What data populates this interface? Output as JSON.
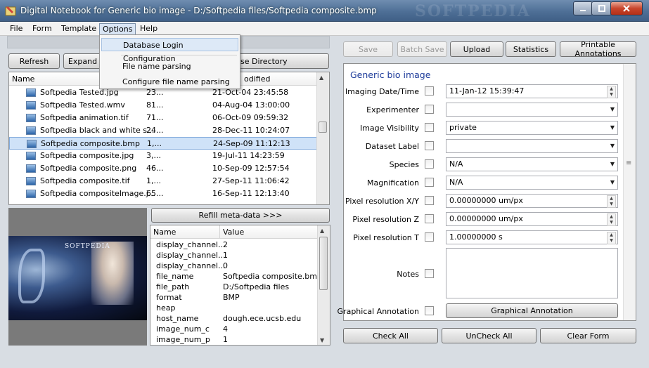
{
  "window": {
    "title": "Digital Notebook for Generic bio image - D:/Softpedia files/Softpedia composite.bmp",
    "watermark": "SOFTPEDIA"
  },
  "menubar": [
    "File",
    "Form",
    "Template",
    "Options",
    "Help"
  ],
  "options_menu": [
    "Database Login Configuration",
    "File name parsing",
    "Configure file name parsing"
  ],
  "left_toolbar": {
    "refresh": "Refresh",
    "expand": "Expand",
    "browse": "se Directory"
  },
  "file_list": {
    "headers": {
      "name": "Name",
      "modified": "odified"
    },
    "rows": [
      {
        "name": "Softpedia Tested.jpg",
        "size": "23...",
        "date": "21-Oct-04 23:45:58"
      },
      {
        "name": "Softpedia Tested.wmv",
        "size": "81...",
        "date": "04-Aug-04 13:00:00"
      },
      {
        "name": "Softpedia animation.tif",
        "size": "71...",
        "date": "06-Oct-09 09:59:32"
      },
      {
        "name": "Softpedia black and white s...",
        "size": "24...",
        "date": "28-Dec-11 10:24:07"
      },
      {
        "name": "Softpedia composite.bmp",
        "size": "1,...",
        "date": "24-Sep-09 11:12:13"
      },
      {
        "name": "Softpedia composite.jpg",
        "size": "3,...",
        "date": "19-Jul-11 14:23:59"
      },
      {
        "name": "Softpedia composite.png",
        "size": "46...",
        "date": "10-Sep-09 12:57:54"
      },
      {
        "name": "Softpedia composite.tif",
        "size": "1,...",
        "date": "27-Sep-11 11:06:42"
      },
      {
        "name": "Softpedia compositeImage.j...",
        "size": "65...",
        "date": "16-Sep-11 12:13:40"
      }
    ],
    "selected_index": 4
  },
  "preview": {
    "logo_text": "SOFTPEDIA"
  },
  "refill_button": "Refill meta-data >>>",
  "meta": {
    "headers": {
      "name": "Name",
      "value": "Value"
    },
    "rows": [
      {
        "k": "display_channel...",
        "v": "2"
      },
      {
        "k": "display_channel...",
        "v": "1"
      },
      {
        "k": "display_channel...",
        "v": "0"
      },
      {
        "k": "file_name",
        "v": "Softpedia composite.bmp"
      },
      {
        "k": "file_path",
        "v": "D:/Softpedia files"
      },
      {
        "k": "format",
        "v": "BMP"
      },
      {
        "k": "heap",
        "v": ""
      },
      {
        "k": "host_name",
        "v": "dough.ece.ucsb.edu"
      },
      {
        "k": "image_num_c",
        "v": "4"
      },
      {
        "k": "image_num_p",
        "v": "1"
      }
    ]
  },
  "right_toolbar": {
    "save": "Save",
    "batch_save": "Batch Save",
    "upload": "Upload",
    "statistics": "Statistics",
    "printable": "Printable Annotations"
  },
  "form": {
    "title": "Generic bio image",
    "imaging_label": "Imaging Date/Time",
    "imaging_value": "11-Jan-12 15:39:47",
    "experimenter_label": "Experimenter",
    "experimenter_value": "",
    "visibility_label": "Image Visibility",
    "visibility_value": "private",
    "dataset_label": "Dataset Label",
    "dataset_value": "",
    "species_label": "Species",
    "species_value": "N/A",
    "magnification_label": "Magnification",
    "magnification_value": "N/A",
    "resxy_label": "Pixel resolution X/Y",
    "resxy_value": "0.00000000 um/px",
    "resz_label": "Pixel resolution Z",
    "resz_value": "0.00000000 um/px",
    "rest_label": "Pixel resolution T",
    "rest_value": "1.00000000 s",
    "notes_label": "Notes",
    "graphical_label": "Graphical Annotation",
    "graphical_button": "Graphical Annotation"
  },
  "bottom_buttons": {
    "check_all": "Check All",
    "uncheck_all": "UnCheck All",
    "clear_form": "Clear Form"
  }
}
